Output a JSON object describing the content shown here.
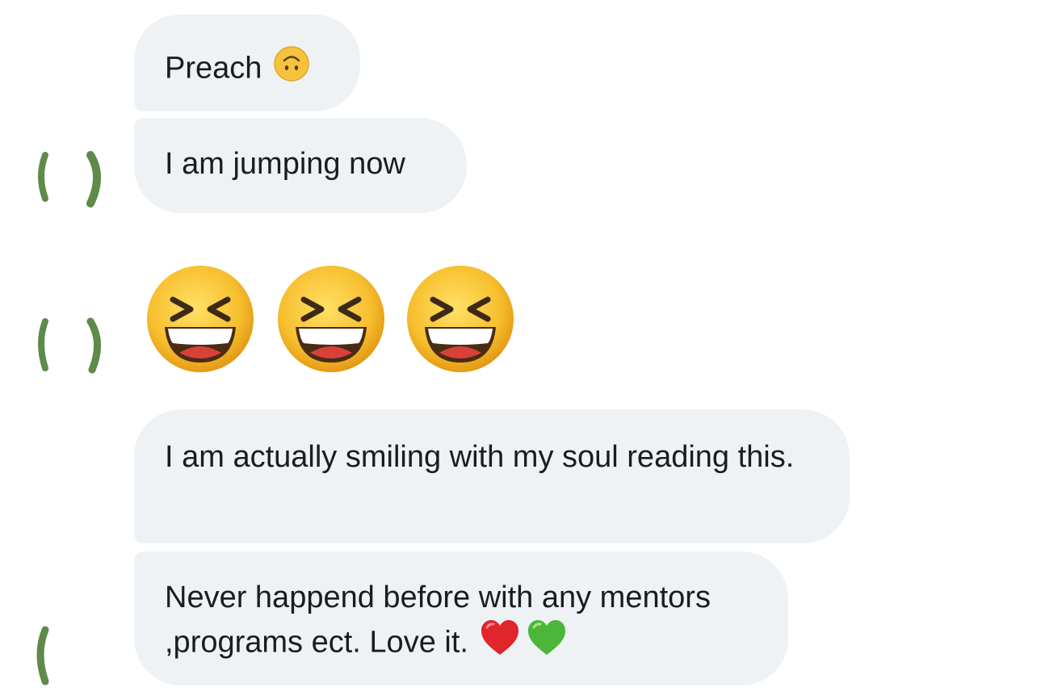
{
  "messages": [
    {
      "text": "Preach",
      "emoji": "upside-down-face-icon"
    },
    {
      "text": "I am jumping now"
    },
    {
      "emoji_only": [
        "grinning-squinting-face-icon",
        "grinning-squinting-face-icon",
        "grinning-squinting-face-icon"
      ]
    },
    {
      "text": "I am actually smiling with my soul reading this."
    },
    {
      "text": "Never happend before with any mentors ,programs ect. Love it.",
      "emojis": [
        "red-heart-icon",
        "green-heart-icon"
      ]
    }
  ],
  "colors": {
    "bubble_background": "#eff2f5",
    "text": "#1c1c1e",
    "avatar_foliage": "#5e8a4a"
  }
}
